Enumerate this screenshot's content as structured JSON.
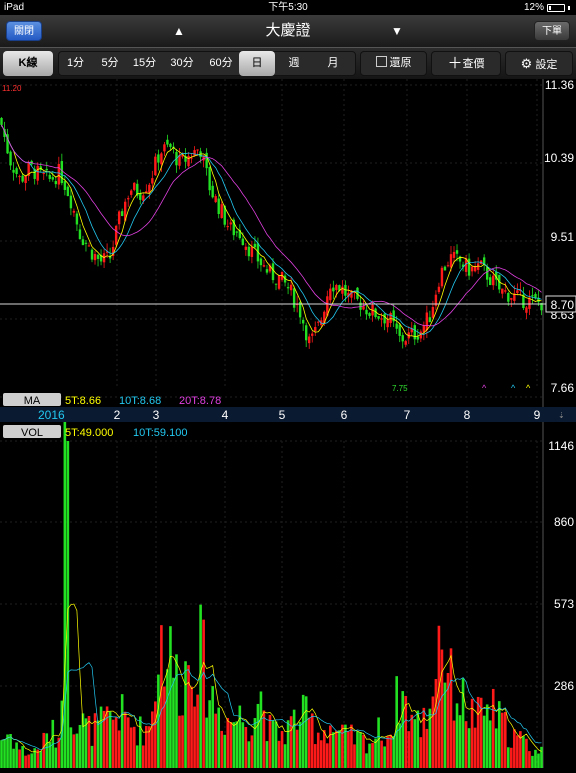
{
  "status": {
    "device": "iPad",
    "time": "下午5:30",
    "battery": "12%"
  },
  "nav": {
    "close_label": "關閉",
    "title": "大慶證",
    "order_label": "下單",
    "prev_icon": "▲",
    "next_icon": "▼"
  },
  "toolbar": {
    "k_label": "K線",
    "periods": [
      "1分",
      "5分",
      "15分",
      "30分",
      "60分",
      "日",
      "週",
      "月"
    ],
    "active_period": "日",
    "restore_label": "還原",
    "lookup_label": "查價",
    "settings_label": "設定"
  },
  "price_chart": {
    "y_ticks": [
      "11.36",
      "10.39",
      "9.51",
      "8.63",
      "7.66"
    ],
    "ymax": 11.36,
    "ymin": 7.66,
    "last_price": "8.70",
    "high_label": "11.20",
    "low_label": "7.75"
  },
  "ma": {
    "title": "MA",
    "ma5": "5T:8.66",
    "ma10": "10T:8.68",
    "ma20": "20T:8.78"
  },
  "axis": {
    "year": "2016",
    "months": [
      "2",
      "3",
      "4",
      "5",
      "6",
      "7",
      "8",
      "9"
    ]
  },
  "vol": {
    "title": "VOL",
    "v5": "5T:49.000",
    "v10": "10T:59.100",
    "y_ticks": [
      "1146",
      "860",
      "573",
      "286"
    ],
    "ymax": 1146
  },
  "colors": {
    "up": "#ff1a1a",
    "down": "#22e022",
    "ma5": "#ffff00",
    "ma10": "#22c8f0",
    "ma20": "#e040e0"
  },
  "chart_data": {
    "type": "candlestick",
    "title": "",
    "x_ticks": [
      "2016",
      "2",
      "3",
      "4",
      "5",
      "6",
      "7",
      "8",
      "9"
    ],
    "price_ylim": [
      7.66,
      11.36
    ],
    "vol_ylim": [
      0,
      1146
    ],
    "close_trend": [
      [
        0,
        10.95
      ],
      [
        10,
        10.45
      ],
      [
        20,
        10.2
      ],
      [
        30,
        10.35
      ],
      [
        40,
        10.25
      ],
      [
        50,
        10.2
      ],
      [
        60,
        10.3
      ],
      [
        70,
        10.0
      ],
      [
        80,
        9.55
      ],
      [
        90,
        9.35
      ],
      [
        100,
        9.2
      ],
      [
        110,
        9.25
      ],
      [
        120,
        9.75
      ],
      [
        130,
        10.1
      ],
      [
        140,
        10.05
      ],
      [
        150,
        10.2
      ],
      [
        160,
        10.55
      ],
      [
        170,
        10.6
      ],
      [
        180,
        10.4
      ],
      [
        190,
        10.5
      ],
      [
        200,
        10.6
      ],
      [
        210,
        10.1
      ],
      [
        220,
        9.85
      ],
      [
        230,
        9.6
      ],
      [
        240,
        9.55
      ],
      [
        250,
        9.35
      ],
      [
        260,
        9.2
      ],
      [
        270,
        9.05
      ],
      [
        280,
        9.0
      ],
      [
        290,
        8.85
      ],
      [
        300,
        8.6
      ],
      [
        310,
        8.2
      ],
      [
        320,
        8.45
      ],
      [
        330,
        8.95
      ],
      [
        340,
        8.9
      ],
      [
        350,
        8.75
      ],
      [
        360,
        8.7
      ],
      [
        370,
        8.6
      ],
      [
        380,
        8.55
      ],
      [
        390,
        8.5
      ],
      [
        400,
        8.25
      ],
      [
        410,
        8.3
      ],
      [
        420,
        8.35
      ],
      [
        430,
        8.55
      ],
      [
        440,
        9.05
      ],
      [
        450,
        9.25
      ],
      [
        460,
        9.2
      ],
      [
        470,
        9.1
      ],
      [
        480,
        9.15
      ],
      [
        490,
        9.0
      ],
      [
        500,
        8.85
      ],
      [
        510,
        8.8
      ],
      [
        520,
        8.75
      ],
      [
        530,
        8.72
      ],
      [
        536,
        8.7
      ]
    ],
    "volume_trend": [
      [
        0,
        120
      ],
      [
        10,
        150
      ],
      [
        20,
        80
      ],
      [
        30,
        60
      ],
      [
        40,
        90
      ],
      [
        50,
        150
      ],
      [
        60,
        130
      ],
      [
        65,
        1146
      ],
      [
        70,
        260
      ],
      [
        80,
        200
      ],
      [
        90,
        160
      ],
      [
        100,
        180
      ],
      [
        110,
        210
      ],
      [
        120,
        230
      ],
      [
        130,
        190
      ],
      [
        140,
        160
      ],
      [
        150,
        180
      ],
      [
        160,
        560
      ],
      [
        170,
        470
      ],
      [
        180,
        350
      ],
      [
        190,
        460
      ],
      [
        200,
        500
      ],
      [
        210,
        320
      ],
      [
        220,
        240
      ],
      [
        230,
        200
      ],
      [
        240,
        220
      ],
      [
        250,
        200
      ],
      [
        260,
        320
      ],
      [
        270,
        160
      ],
      [
        280,
        140
      ],
      [
        290,
        180
      ],
      [
        300,
        230
      ],
      [
        310,
        200
      ],
      [
        320,
        150
      ],
      [
        330,
        180
      ],
      [
        340,
        140
      ],
      [
        350,
        130
      ],
      [
        360,
        120
      ],
      [
        370,
        110
      ],
      [
        380,
        160
      ],
      [
        390,
        140
      ],
      [
        400,
        340
      ],
      [
        410,
        220
      ],
      [
        420,
        180
      ],
      [
        430,
        260
      ],
      [
        440,
        620
      ],
      [
        450,
        360
      ],
      [
        460,
        300
      ],
      [
        470,
        230
      ],
      [
        480,
        210
      ],
      [
        490,
        260
      ],
      [
        500,
        200
      ],
      [
        510,
        150
      ],
      [
        520,
        120
      ],
      [
        530,
        90
      ],
      [
        536,
        70
      ]
    ]
  }
}
